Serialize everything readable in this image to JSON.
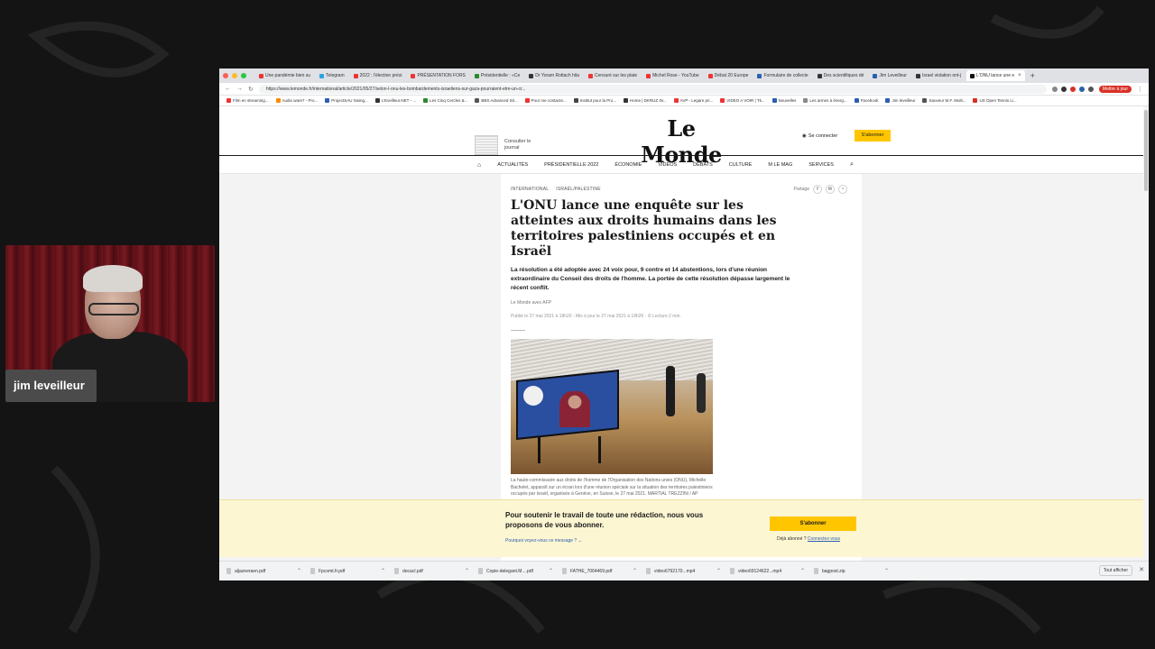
{
  "webcam": {
    "name": "jim leveilleur"
  },
  "browser": {
    "tabs": [
      {
        "label": "Une pandémie bien su",
        "color": "#e33"
      },
      {
        "label": "Telegram",
        "color": "#2aa3df"
      },
      {
        "label": "2022 : l'élection prési",
        "color": "#e33"
      },
      {
        "label": "PRÉSENTATION FORS",
        "color": "#e33"
      },
      {
        "label": "Présidentielle : «Ce",
        "color": "#2a8a2a"
      },
      {
        "label": "Dr Yoram Rottach hila",
        "color": "#333"
      },
      {
        "label": "Censuré sur les plate",
        "color": "#e33"
      },
      {
        "label": "Michel Rose - YouTube",
        "color": "#e33"
      },
      {
        "label": "Débat 20 Europe",
        "color": "#e33"
      },
      {
        "label": "Formulaire de collecte",
        "color": "#2b5fae"
      },
      {
        "label": "Des scientifiques dé",
        "color": "#333"
      },
      {
        "label": "Jim Leveilleur",
        "color": "#2b5fae"
      },
      {
        "label": "Israel violation ont-j",
        "color": "#333"
      },
      {
        "label": "L'ONU lance une e",
        "color": "#111",
        "active": true
      }
    ],
    "url": "https://www.lemonde.fr/international/article/2021/05/27/selon-l-onu-les-bombardements-israeliens-sur-gaza-pourraient-etre-un-cr...",
    "update_label": "Mettre à jour",
    "bookmarks": [
      "Film en streaming...",
      "Audio ware7 - Pro...",
      "ProjectSAU Swing...",
      "L'Eveilleur.NET - ...",
      "Les Cinq Cercles &...",
      "BBS Advanced Sit...",
      "Pour me contacte...",
      "Institut pour la Pro...",
      "Home | DKRUZ IN...",
      "AVP - Legare pri...",
      "VIDEO A VOIR | Tk...",
      "Nouvelles",
      "Les armes à énerg...",
      "Facebook",
      "Jim leveilleur",
      "Sauveur M.F. Multi...",
      "US Open Tennis Li..."
    ],
    "downloads": [
      "aljazeeraen.pdf",
      "Fpcomt.fr.pdf",
      "docacl.pdf",
      "Copie-delegant.M....pdf",
      "FATHE_7064469.pdf",
      "video6792170...mp4",
      "video69124622...mp4",
      "bagpost.zip"
    ],
    "downloads_show_all": "Tout afficher"
  },
  "lemonde": {
    "consult_text": "Consulter le journal",
    "logo": "Le Monde",
    "login": "Se connecter",
    "subscribe": "S'abonner",
    "nav": [
      "ACTUALITÉS",
      "PRÉSIDENTIELLE 2022",
      "ÉCONOMIE",
      "VIDÉOS",
      "DÉBATS",
      "CULTURE",
      "M LE MAG",
      "SERVICES"
    ],
    "article": {
      "crumb1": "INTERNATIONAL",
      "crumb2": "ISRAËL/PALESTINE",
      "share_label": "Partage",
      "headline": "L'ONU lance une enquête sur les atteintes aux droits humains dans les territoires palestiniens occupés et en Israël",
      "lede": "La résolution a été adoptée avec 24 voix pour, 9 contre et 14 abstentions, lors d'une réunion extraordinaire du Conseil des droits de l'homme. La portée de cette résolution dépasse largement le récent conflit.",
      "byline": "Le Monde avec AFP",
      "pubdate": "Publié le 27 mai 2021 à 18h20 - Mis à jour le 27 mai 2021 à 18h26 · ⏱ Lecture 2 min.",
      "caption": "La haute-commissaire aux droits de l'homme de l'Organisation des Nations unies (ONU), Michelle Bachelet, apparaît sur un écran lors d'une réunion spéciale sur la situation des territoires palestiniens occupés par Israël, organisée à Genève, en Suisse, le 27 mai 2021. MARTIAL TREZZINI / AP"
    },
    "banner": {
      "text": "Pour soutenir le travail de toute une rédaction, nous vous proposons de vous abonner.",
      "why": "Pourquoi voyez-vous ce message ? ⌄",
      "button": "S'abonner",
      "already": "Déjà abonné ?",
      "connect": "Connectez-vous"
    }
  }
}
